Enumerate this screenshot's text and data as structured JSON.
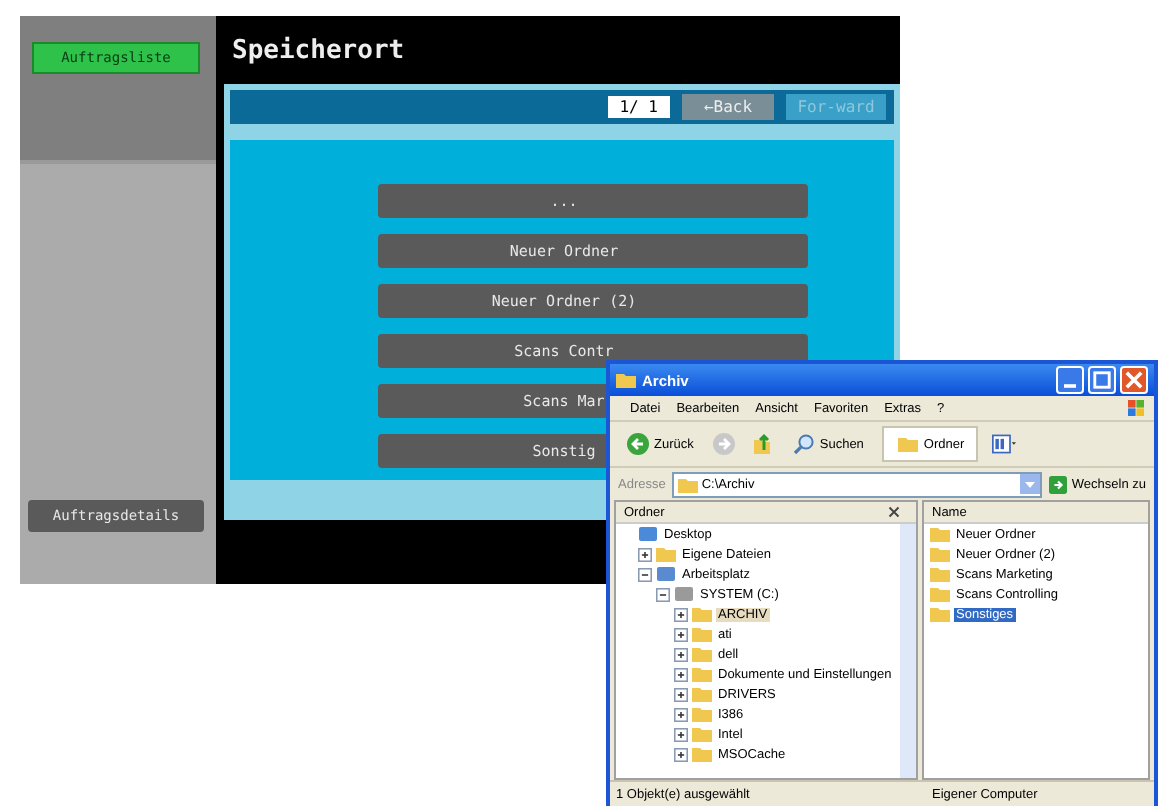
{
  "device": {
    "sidebar": {
      "top_button": "Auftragsliste",
      "bottom_button": "Auftragsdetails"
    },
    "title": "Speicherort",
    "pager": {
      "page": "1/ 1",
      "back": "←Back",
      "forward": "For-ward",
      "forward_disabled": true
    },
    "folders": [
      {
        "label": "..."
      },
      {
        "label": "Neuer Ordner"
      },
      {
        "label": "Neuer Ordner (2)"
      },
      {
        "label": "Scans Contr"
      },
      {
        "label": "Scans Mar"
      },
      {
        "label": "Sonstig"
      }
    ]
  },
  "explorer": {
    "window_title": "Archiv",
    "menu": [
      "Datei",
      "Bearbeiten",
      "Ansicht",
      "Favoriten",
      "Extras",
      "?"
    ],
    "toolbar": {
      "back": "Zurück",
      "search": "Suchen",
      "folders": "Ordner",
      "folders_on": true
    },
    "address_label": "Adresse",
    "address": "C:\\Archiv",
    "go": "Wechseln zu",
    "tree_header": "Ordner",
    "tree": [
      {
        "label": "Desktop",
        "selected": false,
        "children": [
          {
            "label": "Eigene Dateien",
            "expanded": false,
            "selected": false
          },
          {
            "label": "Arbeitsplatz",
            "expanded": true,
            "selected": false,
            "children": [
              {
                "label": "SYSTEM (C:)",
                "expanded": true,
                "selected": false,
                "children": [
                  {
                    "label": "ARCHIV",
                    "expanded": false,
                    "selected": true
                  },
                  {
                    "label": "ati",
                    "expanded": false,
                    "selected": false
                  },
                  {
                    "label": "dell",
                    "expanded": false,
                    "selected": false
                  },
                  {
                    "label": "Dokumente und Einstellungen",
                    "expanded": false,
                    "selected": false
                  },
                  {
                    "label": "DRIVERS",
                    "expanded": false,
                    "selected": false
                  },
                  {
                    "label": "I386",
                    "expanded": false,
                    "selected": false
                  },
                  {
                    "label": "Intel",
                    "expanded": false,
                    "selected": false
                  },
                  {
                    "label": "MSOCache",
                    "expanded": false,
                    "selected": false
                  }
                ]
              }
            ]
          }
        ]
      }
    ],
    "list_header": "Name",
    "files": [
      {
        "name": "Neuer Ordner",
        "selected": false
      },
      {
        "name": "Neuer Ordner (2)",
        "selected": false
      },
      {
        "name": "Scans Marketing",
        "selected": false
      },
      {
        "name": "Scans Controlling",
        "selected": false
      },
      {
        "name": "Sonstiges",
        "selected": true
      }
    ],
    "status": "1 Objekt(e) ausgewählt",
    "status_right": "Eigener Computer"
  }
}
